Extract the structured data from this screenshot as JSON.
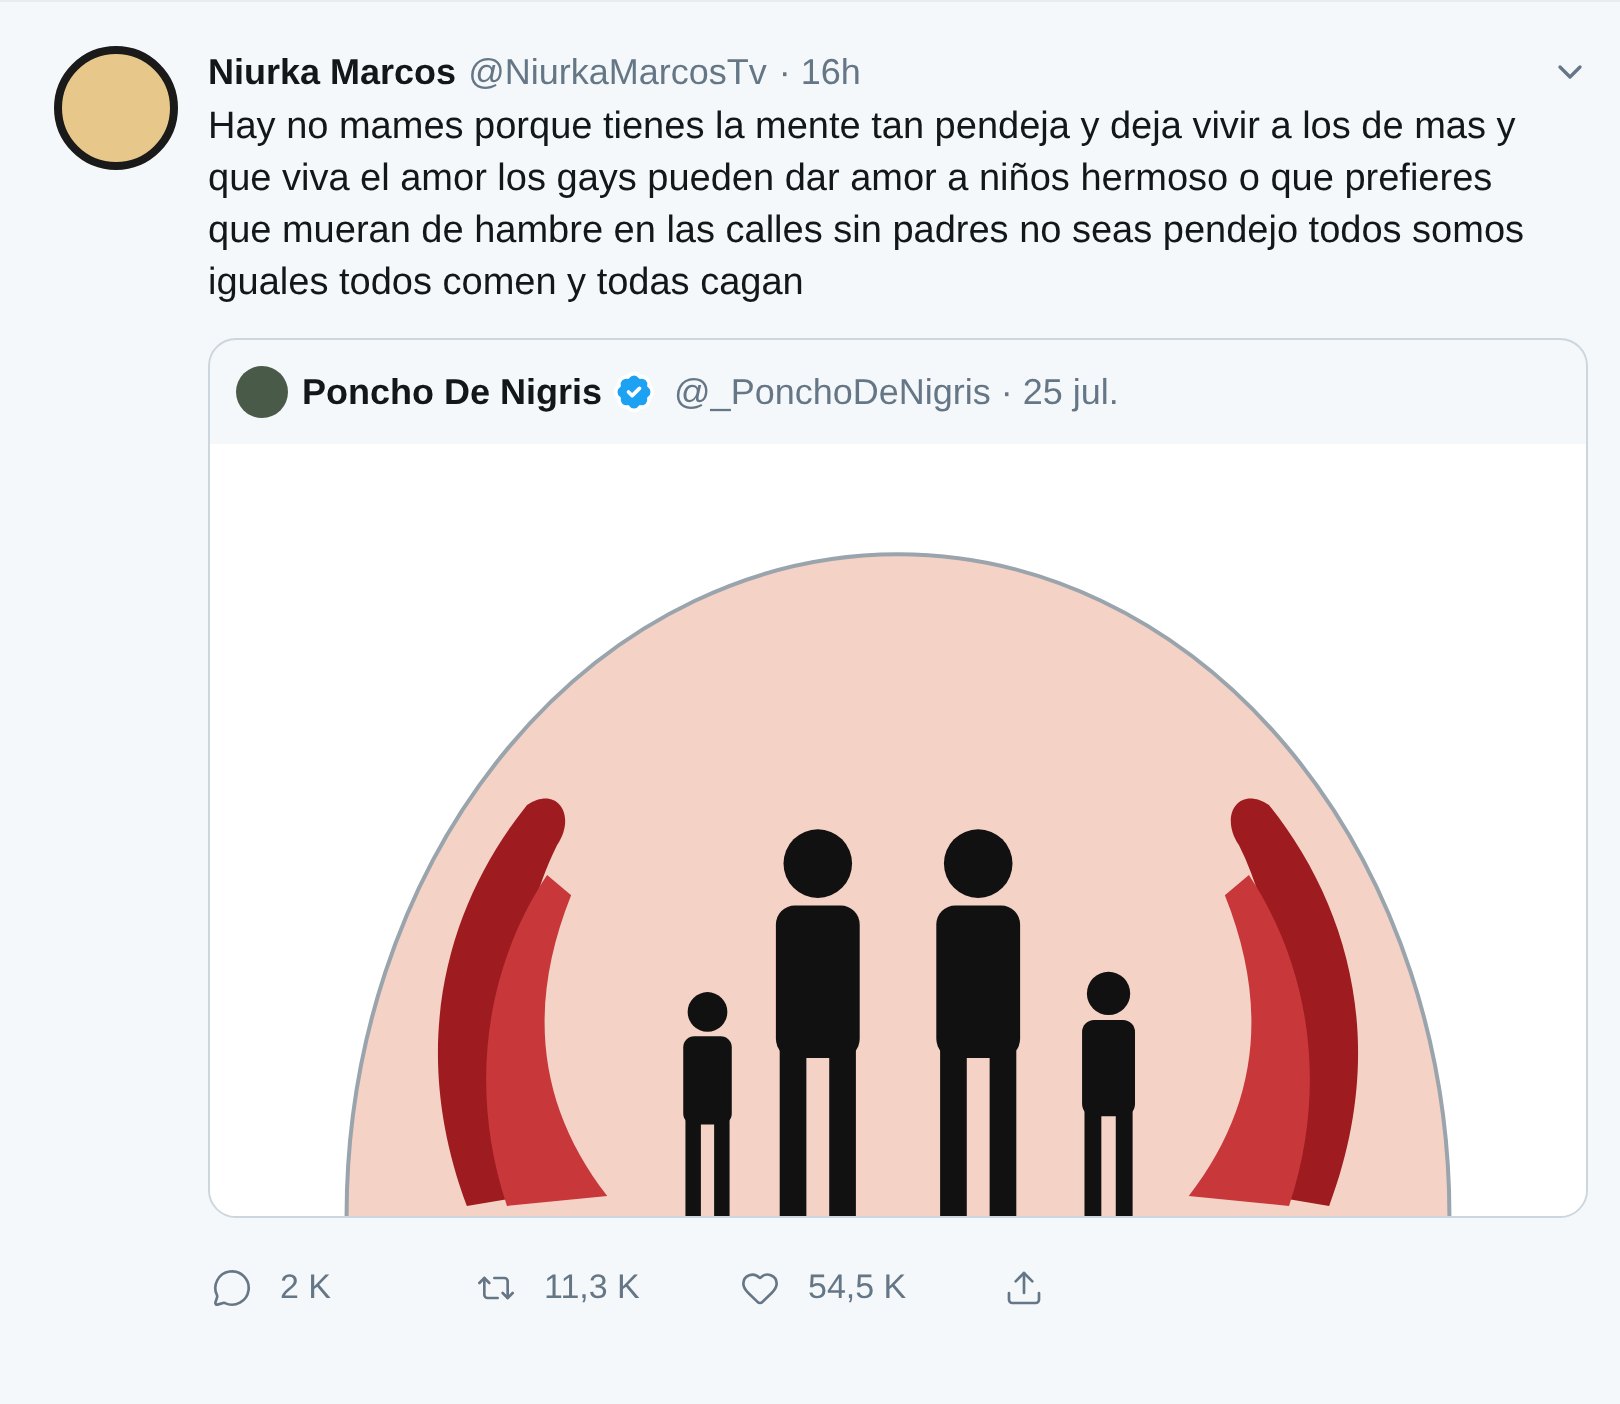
{
  "tweet": {
    "author_name": "Niurka Marcos",
    "handle": "@NiurkaMarcosTv",
    "time": "· 16h",
    "text": "Hay no mames porque tienes la mente tan pendeja y deja vivir a los de mas y que viva el amor los gays pueden dar amor a niños hermoso o que prefieres que mueran de hambre en las calles sin padres no seas pendejo todos somos iguales todos comen y todas cagan",
    "quoted": {
      "author_name": "Poncho De Nigris",
      "verified": true,
      "handle": "@_PonchoDeNigris",
      "time": "· 25 jul."
    },
    "actions": [
      {
        "kind": "reply",
        "count": "2 K"
      },
      {
        "kind": "retweet",
        "count": "11,3 K"
      },
      {
        "kind": "like",
        "count": "54,5 K"
      },
      {
        "kind": "share"
      }
    ]
  }
}
